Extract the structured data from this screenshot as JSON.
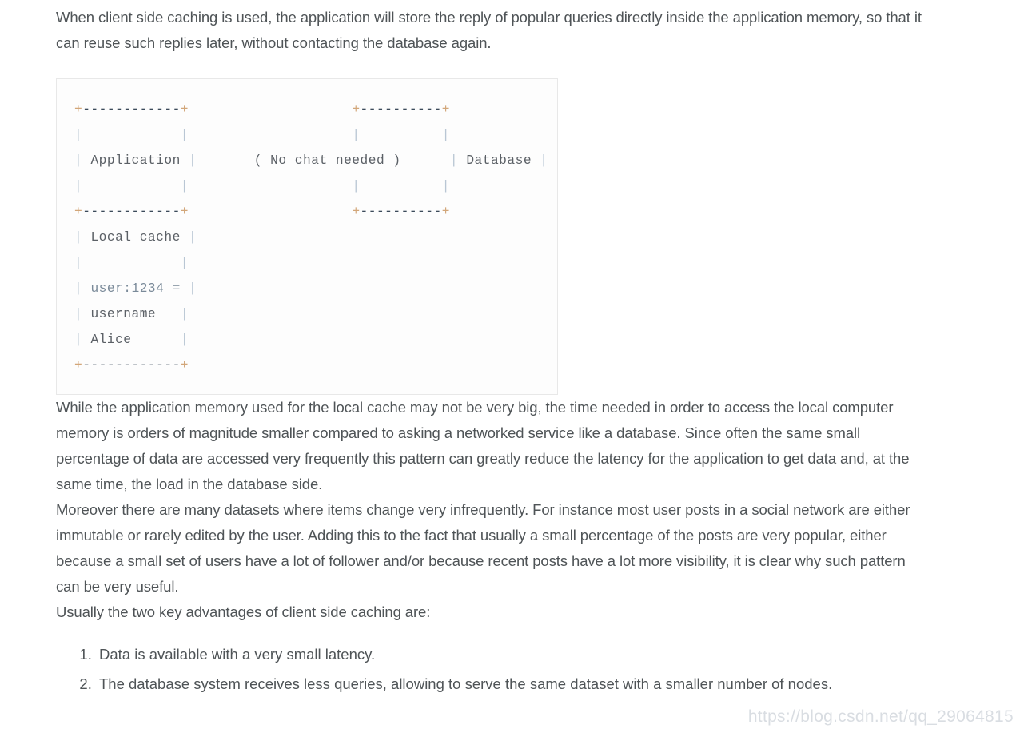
{
  "document": {
    "paragraphs": [
      "When client side caching is used, the application will store the reply of popular queries directly inside the application memory, so that it can reuse such replies later, without contacting the database again.",
      "While the application memory used for the local cache may not be very big, the time needed in order to access the local computer memory is orders of magnitude smaller compared to asking a networked service like a database. Since often the same small percentage of data are accessed very frequently this pattern can greatly reduce the latency for the application to get data and, at the same time, the load in the database side.",
      "Moreover there are many datasets where items change very infrequently. For instance most user posts in a social network are either immutable or rarely edited by the user. Adding this to the fact that usually a small percentage of the posts are very popular, either because a small set of users have a lot of follower and/or because recent posts have a lot more visibility, it is clear why such pattern can be very useful.",
      "Usually the two key advantages of client side caching are:"
    ],
    "advantages": [
      "Data is available with a very small latency.",
      "The database system receives less queries, allowing to serve the same dataset with a smaller number of nodes."
    ],
    "code_block": {
      "language": "text",
      "lines": [
        "+------------+              +----------+",
        "|            |              |          |",
        "| Application |   ( No chat needed )   | Database |",
        "|            |              |          |",
        "+------------+              +----------+",
        "| Local cache |",
        "|            |",
        "| user:1234 = |",
        "| username    |",
        "| Alice       |",
        "+------------+"
      ],
      "raw": "+------------+             +----------+\n|            |             |          |\n| Application |  ( No chat needed )  | Database |\n|            |             |          |\n+------------+             +----------+\n| Local cache |\n|             |\n| user:1234 = |\n| username    |\n| Alice       |\n+------------+",
      "labels": {
        "application": "Application",
        "local_cache": "Local cache",
        "cache_key": "user:1234 =",
        "cache_field": "username",
        "cache_value": "Alice",
        "middle_note": "( No chat needed )",
        "database": "Database"
      }
    },
    "watermark": "https://blog.csdn.net/qq_29064815"
  },
  "colors": {
    "page_background": "#ffffff",
    "body_text": "#4f5457",
    "code_background": "#fdfdfd",
    "code_border": "#e8e8e8",
    "code_text": "#5b6066",
    "code_pipe": "#b9c6d4",
    "code_plus": "#d2a679",
    "code_dash": "#3b4a5a",
    "watermark": "#d9dde2"
  }
}
